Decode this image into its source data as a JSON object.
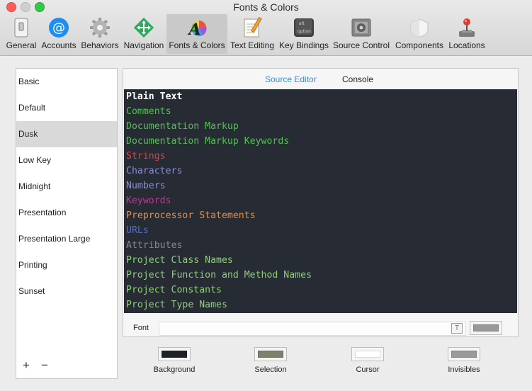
{
  "window": {
    "title": "Fonts & Colors"
  },
  "toolbar": {
    "items": [
      {
        "label": "General",
        "icon": "switch-icon"
      },
      {
        "label": "Accounts",
        "icon": "at-icon"
      },
      {
        "label": "Behaviors",
        "icon": "gear-icon"
      },
      {
        "label": "Navigation",
        "icon": "move-arrows-icon"
      },
      {
        "label": "Fonts & Colors",
        "icon": "font-color-icon"
      },
      {
        "label": "Text Editing",
        "icon": "notepad-pencil-icon"
      },
      {
        "label": "Key Bindings",
        "icon": "keyboard-key-icon"
      },
      {
        "label": "Source Control",
        "icon": "safe-icon"
      },
      {
        "label": "Components",
        "icon": "shield-icon"
      },
      {
        "label": "Locations",
        "icon": "joystick-icon"
      }
    ],
    "key_icon_text": {
      "top": "alt",
      "bottom": "option"
    }
  },
  "themes": {
    "items": [
      "Basic",
      "Default",
      "Dusk",
      "Low Key",
      "Midnight",
      "Presentation",
      "Presentation Large",
      "Printing",
      "Sunset"
    ],
    "selected": "Dusk",
    "add_label": "+",
    "remove_label": "−"
  },
  "editor": {
    "tabs": {
      "source_editor": "Source Editor",
      "console": "Console"
    },
    "code_background": "#272b33",
    "syntax": [
      {
        "text": "Plain Text",
        "color": "#ffffff"
      },
      {
        "text": "Comments",
        "color": "#4ec44e"
      },
      {
        "text": "Documentation Markup",
        "color": "#4ec44e"
      },
      {
        "text": "Documentation Markup Keywords",
        "color": "#4ec44e"
      },
      {
        "text": "Strings",
        "color": "#e4423c"
      },
      {
        "text": "Characters",
        "color": "#8c8cd8"
      },
      {
        "text": "Numbers",
        "color": "#8c8cd8"
      },
      {
        "text": "Keywords",
        "color": "#c2349b"
      },
      {
        "text": "Preprocessor Statements",
        "color": "#e09250"
      },
      {
        "text": "URLs",
        "color": "#4f6bd9"
      },
      {
        "text": "Attributes",
        "color": "#808890"
      },
      {
        "text": "Project Class Names",
        "color": "#8fce7a"
      },
      {
        "text": "Project Function and Method Names",
        "color": "#8fce7a"
      },
      {
        "text": "Project Constants",
        "color": "#8fce7a"
      },
      {
        "text": "Project Type Names",
        "color": "#8fce7a"
      }
    ],
    "font_label": "Font",
    "font_value": "",
    "font_color": "#999999"
  },
  "color_wells": [
    {
      "label": "Background",
      "color": "#1e2028"
    },
    {
      "label": "Selection",
      "color": "#7f806d"
    },
    {
      "label": "Cursor",
      "color": "#ffffff"
    },
    {
      "label": "Invisibles",
      "color": "#9a9a9a"
    }
  ]
}
